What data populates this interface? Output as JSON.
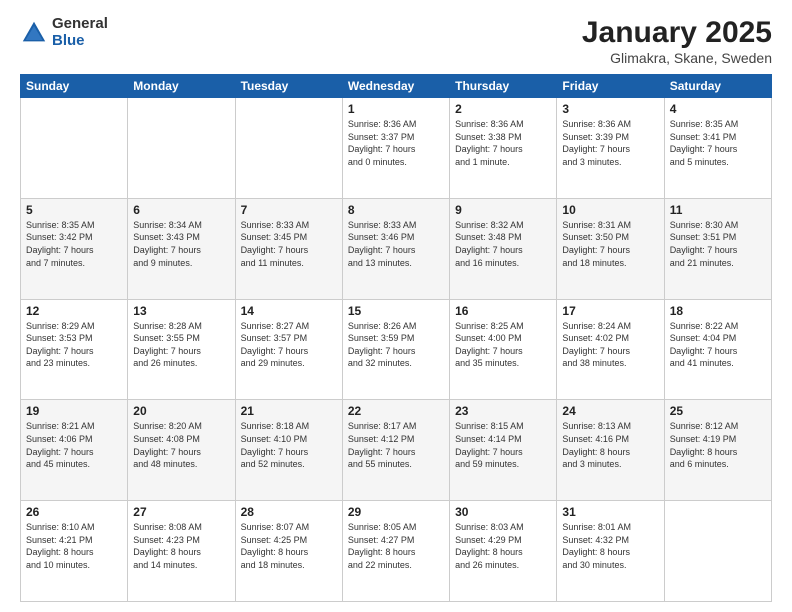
{
  "logo": {
    "general": "General",
    "blue": "Blue"
  },
  "title": "January 2025",
  "subtitle": "Glimakra, Skane, Sweden",
  "weekdays": [
    "Sunday",
    "Monday",
    "Tuesday",
    "Wednesday",
    "Thursday",
    "Friday",
    "Saturday"
  ],
  "weeks": [
    [
      {
        "day": "",
        "info": ""
      },
      {
        "day": "",
        "info": ""
      },
      {
        "day": "",
        "info": ""
      },
      {
        "day": "1",
        "info": "Sunrise: 8:36 AM\nSunset: 3:37 PM\nDaylight: 7 hours\nand 0 minutes."
      },
      {
        "day": "2",
        "info": "Sunrise: 8:36 AM\nSunset: 3:38 PM\nDaylight: 7 hours\nand 1 minute."
      },
      {
        "day": "3",
        "info": "Sunrise: 8:36 AM\nSunset: 3:39 PM\nDaylight: 7 hours\nand 3 minutes."
      },
      {
        "day": "4",
        "info": "Sunrise: 8:35 AM\nSunset: 3:41 PM\nDaylight: 7 hours\nand 5 minutes."
      }
    ],
    [
      {
        "day": "5",
        "info": "Sunrise: 8:35 AM\nSunset: 3:42 PM\nDaylight: 7 hours\nand 7 minutes."
      },
      {
        "day": "6",
        "info": "Sunrise: 8:34 AM\nSunset: 3:43 PM\nDaylight: 7 hours\nand 9 minutes."
      },
      {
        "day": "7",
        "info": "Sunrise: 8:33 AM\nSunset: 3:45 PM\nDaylight: 7 hours\nand 11 minutes."
      },
      {
        "day": "8",
        "info": "Sunrise: 8:33 AM\nSunset: 3:46 PM\nDaylight: 7 hours\nand 13 minutes."
      },
      {
        "day": "9",
        "info": "Sunrise: 8:32 AM\nSunset: 3:48 PM\nDaylight: 7 hours\nand 16 minutes."
      },
      {
        "day": "10",
        "info": "Sunrise: 8:31 AM\nSunset: 3:50 PM\nDaylight: 7 hours\nand 18 minutes."
      },
      {
        "day": "11",
        "info": "Sunrise: 8:30 AM\nSunset: 3:51 PM\nDaylight: 7 hours\nand 21 minutes."
      }
    ],
    [
      {
        "day": "12",
        "info": "Sunrise: 8:29 AM\nSunset: 3:53 PM\nDaylight: 7 hours\nand 23 minutes."
      },
      {
        "day": "13",
        "info": "Sunrise: 8:28 AM\nSunset: 3:55 PM\nDaylight: 7 hours\nand 26 minutes."
      },
      {
        "day": "14",
        "info": "Sunrise: 8:27 AM\nSunset: 3:57 PM\nDaylight: 7 hours\nand 29 minutes."
      },
      {
        "day": "15",
        "info": "Sunrise: 8:26 AM\nSunset: 3:59 PM\nDaylight: 7 hours\nand 32 minutes."
      },
      {
        "day": "16",
        "info": "Sunrise: 8:25 AM\nSunset: 4:00 PM\nDaylight: 7 hours\nand 35 minutes."
      },
      {
        "day": "17",
        "info": "Sunrise: 8:24 AM\nSunset: 4:02 PM\nDaylight: 7 hours\nand 38 minutes."
      },
      {
        "day": "18",
        "info": "Sunrise: 8:22 AM\nSunset: 4:04 PM\nDaylight: 7 hours\nand 41 minutes."
      }
    ],
    [
      {
        "day": "19",
        "info": "Sunrise: 8:21 AM\nSunset: 4:06 PM\nDaylight: 7 hours\nand 45 minutes."
      },
      {
        "day": "20",
        "info": "Sunrise: 8:20 AM\nSunset: 4:08 PM\nDaylight: 7 hours\nand 48 minutes."
      },
      {
        "day": "21",
        "info": "Sunrise: 8:18 AM\nSunset: 4:10 PM\nDaylight: 7 hours\nand 52 minutes."
      },
      {
        "day": "22",
        "info": "Sunrise: 8:17 AM\nSunset: 4:12 PM\nDaylight: 7 hours\nand 55 minutes."
      },
      {
        "day": "23",
        "info": "Sunrise: 8:15 AM\nSunset: 4:14 PM\nDaylight: 7 hours\nand 59 minutes."
      },
      {
        "day": "24",
        "info": "Sunrise: 8:13 AM\nSunset: 4:16 PM\nDaylight: 8 hours\nand 3 minutes."
      },
      {
        "day": "25",
        "info": "Sunrise: 8:12 AM\nSunset: 4:19 PM\nDaylight: 8 hours\nand 6 minutes."
      }
    ],
    [
      {
        "day": "26",
        "info": "Sunrise: 8:10 AM\nSunset: 4:21 PM\nDaylight: 8 hours\nand 10 minutes."
      },
      {
        "day": "27",
        "info": "Sunrise: 8:08 AM\nSunset: 4:23 PM\nDaylight: 8 hours\nand 14 minutes."
      },
      {
        "day": "28",
        "info": "Sunrise: 8:07 AM\nSunset: 4:25 PM\nDaylight: 8 hours\nand 18 minutes."
      },
      {
        "day": "29",
        "info": "Sunrise: 8:05 AM\nSunset: 4:27 PM\nDaylight: 8 hours\nand 22 minutes."
      },
      {
        "day": "30",
        "info": "Sunrise: 8:03 AM\nSunset: 4:29 PM\nDaylight: 8 hours\nand 26 minutes."
      },
      {
        "day": "31",
        "info": "Sunrise: 8:01 AM\nSunset: 4:32 PM\nDaylight: 8 hours\nand 30 minutes."
      },
      {
        "day": "",
        "info": ""
      }
    ]
  ]
}
